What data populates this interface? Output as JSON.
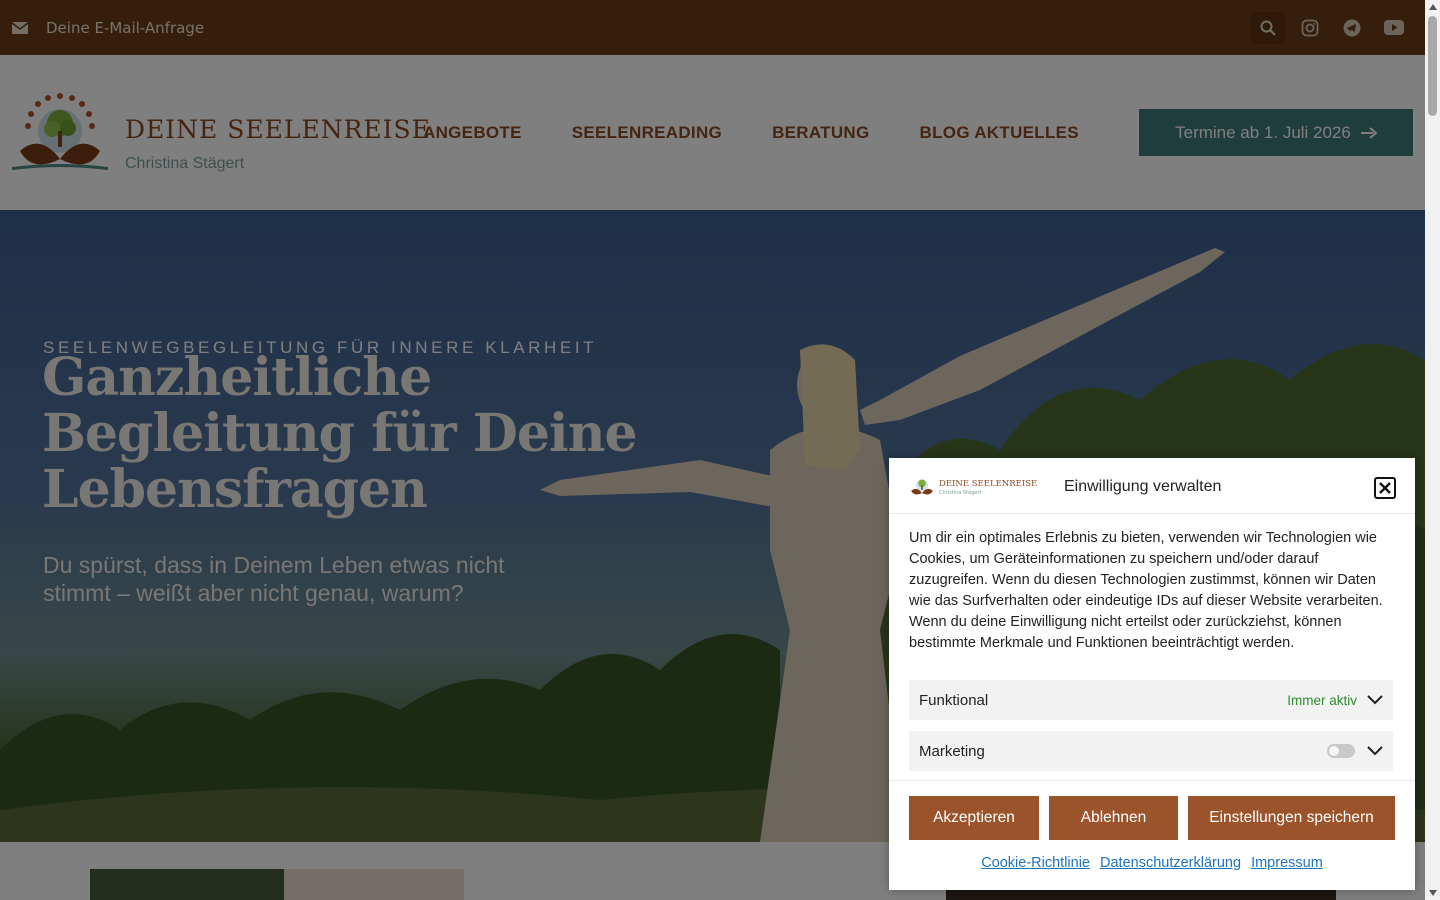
{
  "topbar": {
    "email_label": "Deine E-Mail-Anfrage",
    "icons": [
      "envelope-icon",
      "search-icon",
      "instagram-icon",
      "telegram-icon",
      "youtube-icon"
    ]
  },
  "header": {
    "brand": "DEINE SEELENREISE",
    "owner": "Christina Stägert",
    "nav": [
      "ANGEBOTE",
      "SEELENREADING",
      "BERATUNG",
      "BLOG AKTUELLES"
    ],
    "cta_label": "Termine ab 1. Juli 2026"
  },
  "hero": {
    "kicker": "SEELENWEGBEGLEITUNG FÜR INNERE KLARHEIT",
    "title": "Ganzheitliche Begleitung für Deine Lebensfragen",
    "subtitle": "Du spürst, dass in Deinem Leben etwas nicht stimmt – weißt aber nicht genau, warum?"
  },
  "cookie": {
    "logo_brand": "DEINE SEELENREISE",
    "logo_owner": "Christina Stägert",
    "title": "Einwilligung verwalten",
    "body": "Um dir ein optimales Erlebnis zu bieten, verwenden wir Technologien wie Cookies, um Geräteinformationen zu speichern und/oder darauf zuzugreifen. Wenn du diesen Technologien zustimmst, können wir Daten wie das Surfverhalten oder eindeutige IDs auf dieser Website verarbeiten. Wenn du deine Einwilligung nicht erteilst oder zurückziehst, können bestimmte Merkmale und Funktionen beeinträchtigt werden.",
    "categories": [
      {
        "label": "Funktional",
        "status": "Immer aktiv"
      },
      {
        "label": "Marketing",
        "enabled": false
      }
    ],
    "buttons": {
      "accept": "Akzeptieren",
      "deny": "Ablehnen",
      "save": "Einstellungen speichern"
    },
    "links": [
      "Cookie-Richtlinie",
      "Datenschutzerklärung",
      "Impressum"
    ]
  },
  "colors": {
    "topbar": "#6b3d17",
    "brand_brown": "#8a4a22",
    "cta_teal": "#3f7a76",
    "button_brown": "#9a532a",
    "link_blue": "#1e73be",
    "status_green": "#2e8b2e"
  }
}
